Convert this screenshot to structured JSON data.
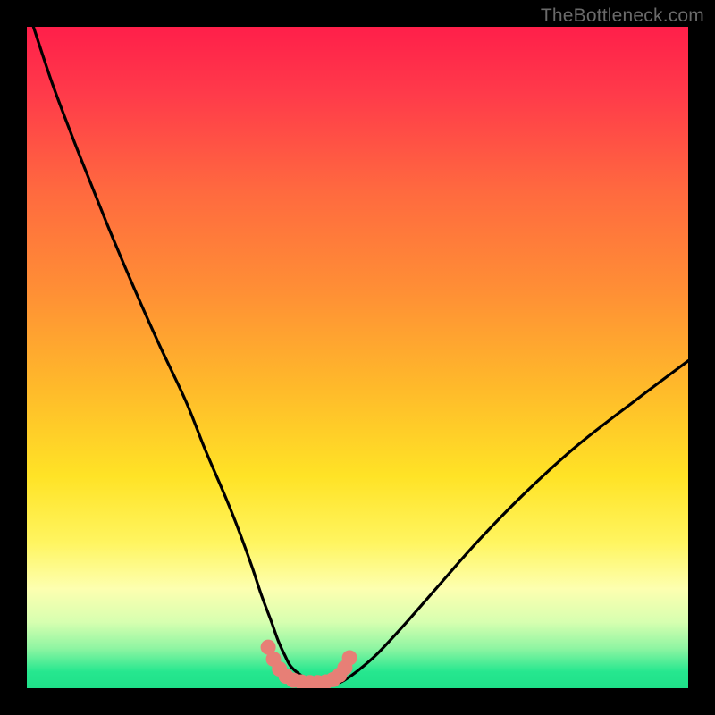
{
  "watermark": "TheBottleneck.com",
  "colors": {
    "frame": "#000000",
    "curve": "#000000",
    "dots": "#e77f76",
    "gradient_stops": [
      {
        "offset": 0.0,
        "color": "#ff1f4a"
      },
      {
        "offset": 0.1,
        "color": "#ff3a4a"
      },
      {
        "offset": 0.25,
        "color": "#ff6a3f"
      },
      {
        "offset": 0.4,
        "color": "#ff8f35"
      },
      {
        "offset": 0.55,
        "color": "#ffbb2a"
      },
      {
        "offset": 0.68,
        "color": "#ffe326"
      },
      {
        "offset": 0.78,
        "color": "#fff560"
      },
      {
        "offset": 0.85,
        "color": "#fdffb0"
      },
      {
        "offset": 0.9,
        "color": "#d7ffb0"
      },
      {
        "offset": 0.94,
        "color": "#8ef5a2"
      },
      {
        "offset": 0.975,
        "color": "#26e78f"
      },
      {
        "offset": 1.0,
        "color": "#1fe089"
      }
    ]
  },
  "chart_data": {
    "type": "line",
    "title": "",
    "xlabel": "",
    "ylabel": "",
    "xlim": [
      0,
      100
    ],
    "ylim": [
      0,
      100
    ],
    "series": [
      {
        "name": "bottleneck-curve",
        "x": [
          1,
          4,
          8,
          12,
          16,
          20,
          24,
          27,
          30,
          32,
          34,
          35.5,
          37,
          38,
          39,
          40,
          42,
          44,
          46,
          47,
          48,
          50,
          53,
          57,
          62,
          68,
          75,
          83,
          92,
          100
        ],
        "y": [
          100,
          91,
          80.5,
          70.5,
          61,
          52,
          43.5,
          36,
          29,
          24,
          18.5,
          14,
          10,
          7.2,
          5,
          3.2,
          1.6,
          0.8,
          0.7,
          0.8,
          1.2,
          2.6,
          5.2,
          9.5,
          15.2,
          22,
          29.2,
          36.5,
          43.5,
          49.5
        ]
      }
    ],
    "flat_bottom_dots": {
      "name": "min-region-markers",
      "x": [
        36.5,
        37.3,
        38.2,
        39.2,
        40.3,
        41.5,
        42.8,
        44.0,
        45.2,
        46.3,
        47.3,
        48.1,
        48.8
      ],
      "y": [
        6.2,
        4.4,
        2.9,
        1.8,
        1.2,
        0.95,
        0.85,
        0.85,
        0.95,
        1.3,
        2.0,
        3.1,
        4.6
      ]
    }
  }
}
